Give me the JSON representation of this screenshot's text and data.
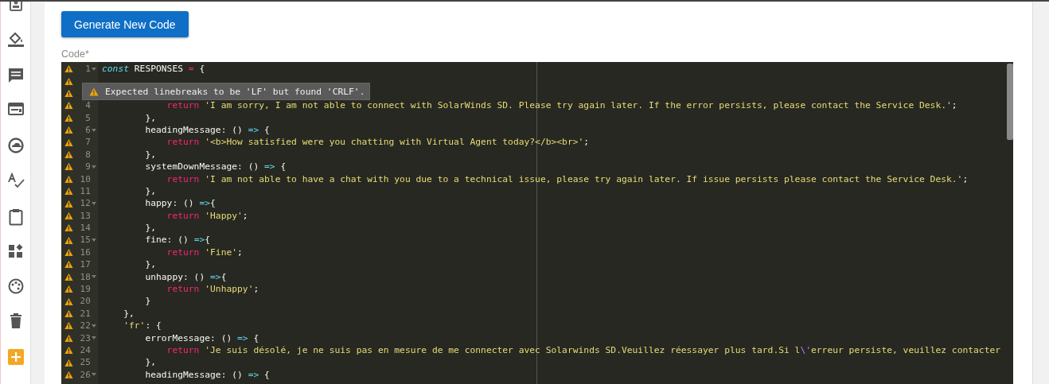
{
  "sidebar": {
    "icons": [
      {
        "kind": "contact"
      },
      {
        "kind": "paint"
      },
      {
        "kind": "chat"
      },
      {
        "kind": "window"
      },
      {
        "kind": "cloud"
      },
      {
        "kind": "spell"
      },
      {
        "kind": "clipboard"
      },
      {
        "kind": "widgets"
      },
      {
        "kind": "palette"
      },
      {
        "kind": "trash"
      },
      {
        "kind": "add"
      }
    ]
  },
  "button": "Generate New Code",
  "code_label": "Code*",
  "editor": {
    "tooltip": "Expected linebreaks to be 'LF' but found 'CRLF'.",
    "lines": [
      {
        "number": "1",
        "foldable": true,
        "warning": true,
        "tokens": [
          {
            "kind": "storage",
            "text": "const"
          },
          {
            "kind": "plain",
            "text": " RESPONSES "
          },
          {
            "kind": "op",
            "text": "="
          },
          {
            "kind": "plain",
            "text": " {"
          }
        ]
      },
      {
        "warning": true,
        "foldable": false
      },
      {
        "warning": true,
        "foldable": false
      },
      {
        "number": "4",
        "foldable": false,
        "warning": true,
        "tokens": [
          {
            "kind": "keyword",
            "text": "            return"
          },
          {
            "kind": "string",
            "text": " 'I am sorry, I am not able to connect with SolarWinds SD. Please try again later. If the error persists, please contact the Service Desk.'"
          },
          {
            "kind": "plain",
            "text": ";"
          }
        ]
      },
      {
        "number": "5",
        "foldable": false,
        "warning": true,
        "tokens": [
          {
            "kind": "plain",
            "text": "        },"
          }
        ]
      },
      {
        "number": "6",
        "foldable": true,
        "warning": true,
        "tokens": [
          {
            "kind": "plain",
            "text": "        headingMessage: () "
          },
          {
            "kind": "arrow",
            "text": "=>"
          },
          {
            "kind": "plain",
            "text": " {"
          }
        ]
      },
      {
        "number": "7",
        "foldable": false,
        "warning": true,
        "tokens": [
          {
            "kind": "keyword",
            "text": "            return"
          },
          {
            "kind": "string",
            "text": " '<b>How satisfied were you chatting with Virtual Agent today?</b><br>'"
          },
          {
            "kind": "plain",
            "text": ";"
          }
        ]
      },
      {
        "number": "8",
        "foldable": false,
        "warning": true,
        "tokens": [
          {
            "kind": "plain",
            "text": "        },"
          }
        ]
      },
      {
        "number": "9",
        "foldable": true,
        "warning": true,
        "tokens": [
          {
            "kind": "plain",
            "text": "        systemDownMessage: () "
          },
          {
            "kind": "arrow",
            "text": "=>"
          },
          {
            "kind": "plain",
            "text": " {"
          }
        ]
      },
      {
        "number": "10",
        "foldable": false,
        "warning": true,
        "tokens": [
          {
            "kind": "keyword",
            "text": "            return"
          },
          {
            "kind": "string",
            "text": " 'I am not able to have a chat with you due to a technical issue, please try again later. If issue persists please contact the Service Desk.'"
          },
          {
            "kind": "plain",
            "text": ";"
          }
        ]
      },
      {
        "number": "11",
        "foldable": false,
        "warning": true,
        "tokens": [
          {
            "kind": "plain",
            "text": "        },"
          }
        ]
      },
      {
        "number": "12",
        "foldable": true,
        "warning": true,
        "tokens": [
          {
            "kind": "plain",
            "text": "        happy: () "
          },
          {
            "kind": "arrow",
            "text": "=>"
          },
          {
            "kind": "plain",
            "text": "{"
          }
        ]
      },
      {
        "number": "13",
        "foldable": false,
        "warning": true,
        "tokens": [
          {
            "kind": "keyword",
            "text": "            return"
          },
          {
            "kind": "string",
            "text": " 'Happy'"
          },
          {
            "kind": "plain",
            "text": ";"
          }
        ]
      },
      {
        "number": "14",
        "foldable": false,
        "warning": true,
        "tokens": [
          {
            "kind": "plain",
            "text": "        },"
          }
        ]
      },
      {
        "number": "15",
        "foldable": true,
        "warning": true,
        "tokens": [
          {
            "kind": "plain",
            "text": "        fine: () "
          },
          {
            "kind": "arrow",
            "text": "=>"
          },
          {
            "kind": "plain",
            "text": "{"
          }
        ]
      },
      {
        "number": "16",
        "foldable": false,
        "warning": true,
        "tokens": [
          {
            "kind": "keyword",
            "text": "            return"
          },
          {
            "kind": "string",
            "text": " 'Fine'"
          },
          {
            "kind": "plain",
            "text": ";"
          }
        ]
      },
      {
        "number": "17",
        "foldable": false,
        "warning": true,
        "tokens": [
          {
            "kind": "plain",
            "text": "        },"
          }
        ]
      },
      {
        "number": "18",
        "foldable": true,
        "warning": true,
        "tokens": [
          {
            "kind": "plain",
            "text": "        unhappy: () "
          },
          {
            "kind": "arrow",
            "text": "=>"
          },
          {
            "kind": "plain",
            "text": "{"
          }
        ]
      },
      {
        "number": "19",
        "foldable": false,
        "warning": true,
        "tokens": [
          {
            "kind": "keyword",
            "text": "            return"
          },
          {
            "kind": "string",
            "text": " 'Unhappy'"
          },
          {
            "kind": "plain",
            "text": ";"
          }
        ]
      },
      {
        "number": "20",
        "foldable": false,
        "warning": true,
        "tokens": [
          {
            "kind": "plain",
            "text": "        }"
          }
        ]
      },
      {
        "number": "21",
        "foldable": false,
        "warning": true,
        "tokens": [
          {
            "kind": "plain",
            "text": "    },"
          }
        ]
      },
      {
        "number": "22",
        "foldable": true,
        "warning": true,
        "tokens": [
          {
            "kind": "string",
            "text": "    'fr'"
          },
          {
            "kind": "plain",
            "text": ": {"
          }
        ]
      },
      {
        "number": "23",
        "foldable": true,
        "warning": true,
        "tokens": [
          {
            "kind": "plain",
            "text": "        errorMessage: () "
          },
          {
            "kind": "arrow",
            "text": "=>"
          },
          {
            "kind": "plain",
            "text": " {"
          }
        ]
      },
      {
        "number": "24",
        "foldable": false,
        "warning": true,
        "tokens": [
          {
            "kind": "keyword",
            "text": "            return"
          },
          {
            "kind": "string",
            "text": " 'Je suis désolé, je ne suis pas en mesure de me connecter avec Solarwinds SD.Veuillez réessayer plus tard.Si l"
          },
          {
            "kind": "escape",
            "text": "\\'"
          },
          {
            "kind": "string",
            "text": "erreur persiste, veuillez contacter"
          }
        ]
      },
      {
        "number": "25",
        "foldable": false,
        "warning": true,
        "tokens": [
          {
            "kind": "plain",
            "text": "        },"
          }
        ]
      },
      {
        "number": "26",
        "foldable": true,
        "warning": true,
        "tokens": [
          {
            "kind": "plain",
            "text": "        headingMessage: () "
          },
          {
            "kind": "arrow",
            "text": "=>"
          },
          {
            "kind": "plain",
            "text": " {"
          }
        ]
      }
    ]
  }
}
